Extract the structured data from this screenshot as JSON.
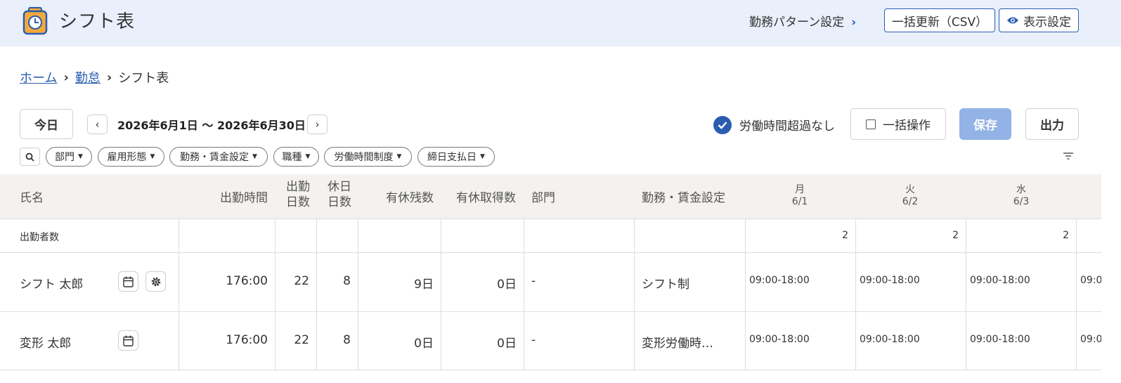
{
  "header": {
    "title": "シフト表",
    "pattern_link": "勤務パターン設定",
    "csv_button": "一括更新（CSV）",
    "display_button": "表示設定"
  },
  "breadcrumb": {
    "home": "ホーム",
    "attendance": "勤怠",
    "current": "シフト表"
  },
  "toolbar": {
    "today": "今日",
    "period": "2026年6月1日 〜 2026年6月30日",
    "overtime_label": "労働時間超過なし",
    "bulk_label": "一括操作",
    "save": "保存",
    "export": "出力"
  },
  "filters": [
    "部門",
    "雇用形態",
    "勤務・賃金設定",
    "職種",
    "労働時間制度",
    "締日支払日"
  ],
  "table": {
    "headers": {
      "name": "氏名",
      "work_time": "出勤時間",
      "work_days_1": "出勤",
      "work_days_2": "日数",
      "holiday_days_1": "休日",
      "holiday_days_2": "日数",
      "leave_remaining": "有休残数",
      "leave_taken": "有休取得数",
      "department": "部門",
      "wage_setting": "勤務・賃金設定"
    },
    "days": [
      {
        "weekday": "月",
        "date": "6/1"
      },
      {
        "weekday": "火",
        "date": "6/2"
      },
      {
        "weekday": "水",
        "date": "6/3"
      }
    ],
    "summary": {
      "label": "出勤者数",
      "counts": [
        "2",
        "2",
        "2"
      ]
    },
    "rows": [
      {
        "name": "シフト 太郎",
        "work_time": "176:00",
        "work_days": "22",
        "holiday_days": "8",
        "leave_remaining": "9日",
        "leave_taken": "0日",
        "department": "-",
        "wage_setting": "シフト制",
        "shifts": [
          "09:00-18:00",
          "09:00-18:00",
          "09:00-18:00",
          "09:0"
        ]
      },
      {
        "name": "変形 太郎",
        "work_time": "176:00",
        "work_days": "22",
        "holiday_days": "8",
        "leave_remaining": "0日",
        "leave_taken": "0日",
        "department": "-",
        "wage_setting": "変形労働時…",
        "shifts": [
          "09:00-18:00",
          "09:00-18:00",
          "09:00-18:00",
          "09:0"
        ]
      }
    ]
  },
  "colors": {
    "header_bg": "#e9f0fb",
    "accent": "#2a5db0",
    "save_disabled": "#93b2e6",
    "table_head_bg": "#f4f2ee"
  }
}
